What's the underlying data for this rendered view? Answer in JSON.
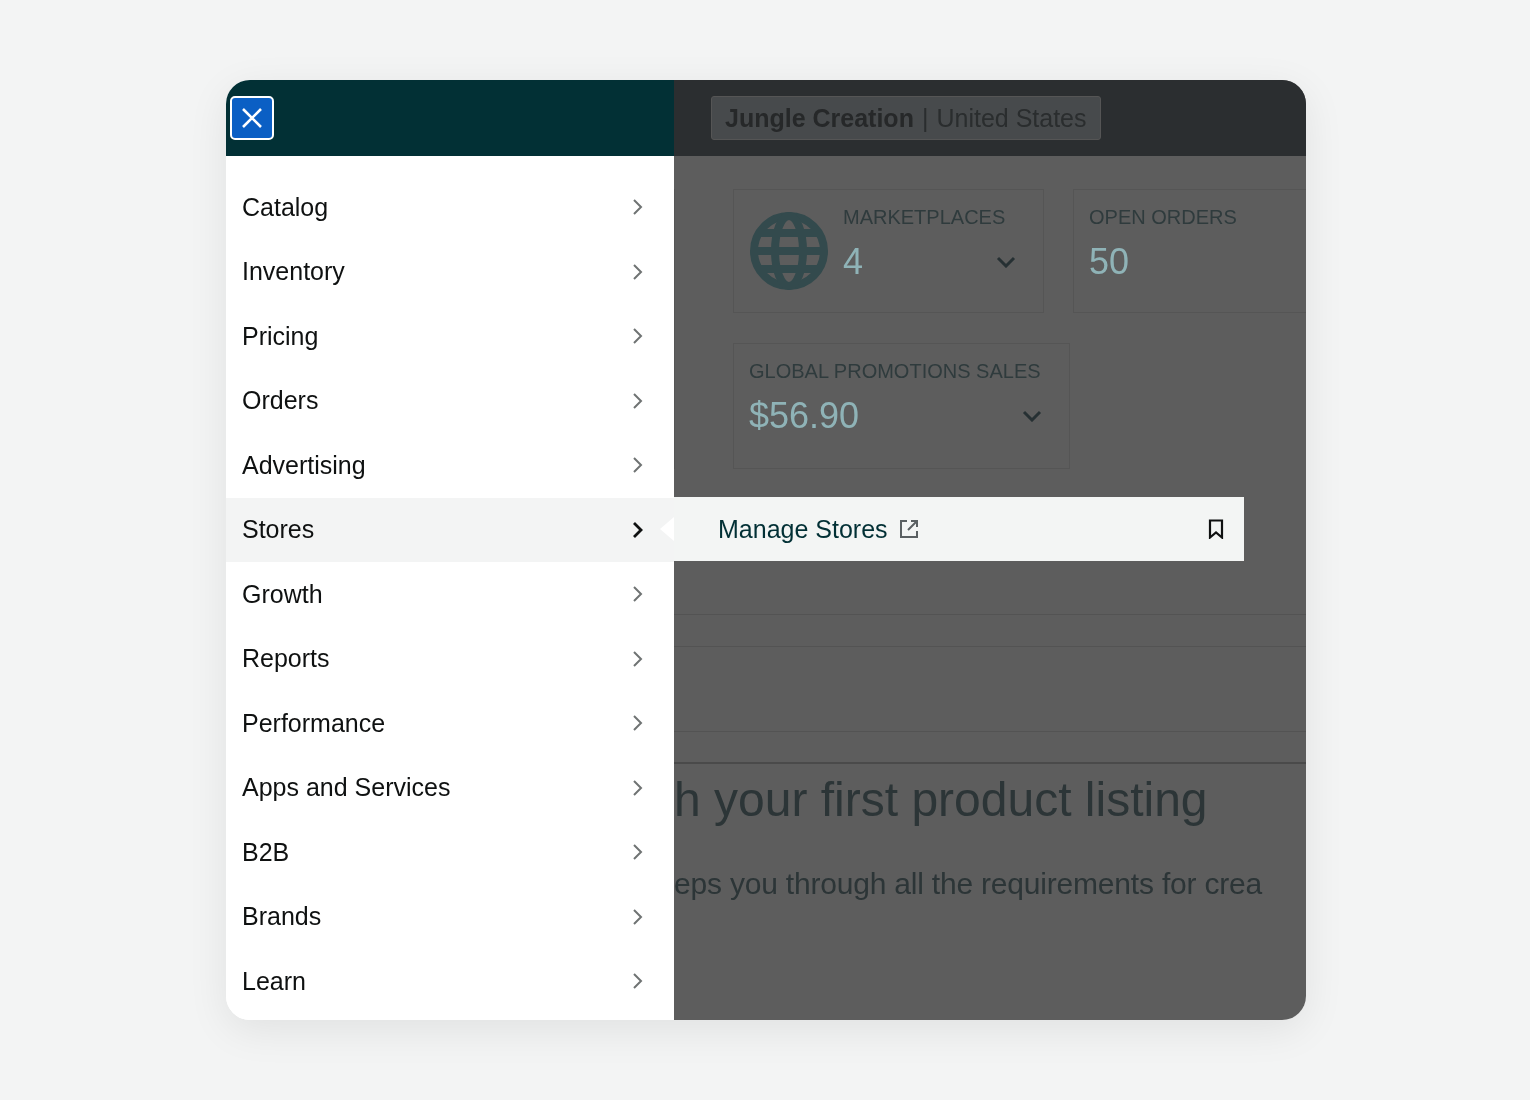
{
  "menu": {
    "items": [
      {
        "label": "Catalog",
        "selected": false
      },
      {
        "label": "Inventory",
        "selected": false
      },
      {
        "label": "Pricing",
        "selected": false
      },
      {
        "label": "Orders",
        "selected": false
      },
      {
        "label": "Advertising",
        "selected": false
      },
      {
        "label": "Stores",
        "selected": true
      },
      {
        "label": "Growth",
        "selected": false
      },
      {
        "label": "Reports",
        "selected": false
      },
      {
        "label": "Performance",
        "selected": false
      },
      {
        "label": "Apps and Services",
        "selected": false
      },
      {
        "label": "B2B",
        "selected": false
      },
      {
        "label": "Brands",
        "selected": false
      },
      {
        "label": "Learn",
        "selected": false
      }
    ]
  },
  "flyout": {
    "items": [
      {
        "label": "Manage Stores",
        "external": true,
        "bookmarked": false
      }
    ]
  },
  "background": {
    "store_switcher": {
      "store_name": "Jungle Creation",
      "separator": "|",
      "region": "United States"
    },
    "cards": [
      {
        "kind": "with_icon",
        "title": "MARKETPLACES",
        "value": "4",
        "expandable": true
      },
      {
        "kind": "plain",
        "title": "OPEN ORDERS",
        "value": "50"
      },
      {
        "kind": "plain",
        "title": "GLOBAL PROMOTIONS SALES",
        "value": "$56.90",
        "expandable": true
      }
    ],
    "headline": "h your first product listing",
    "subtext": "eps you through all the requirements for crea"
  }
}
